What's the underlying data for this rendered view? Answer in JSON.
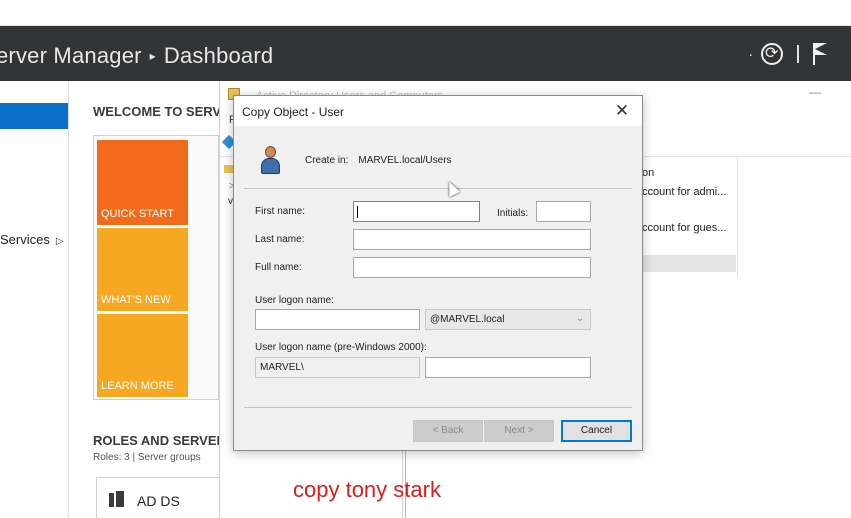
{
  "top_strip": {
    "text": ""
  },
  "header": {
    "app_title": "erver Manager",
    "separator": "▸",
    "page": "Dashboard"
  },
  "leftnav": {
    "services_label": "Services",
    "services_arrow": "▷"
  },
  "dashboard": {
    "welcome": "WELCOME TO SERVE",
    "tiles": {
      "quick_start": "QUICK START",
      "whats_new": "WHAT'S NEW",
      "learn_more": "LEARN MORE"
    },
    "roles_title": "ROLES AND SERVER",
    "roles_sub": "Roles: 3   |   Server groups",
    "adds_label": "AD DS"
  },
  "ad_window": {
    "title": "Active Directory Users and Computers",
    "menu_f": "F",
    "tree_gt": ">",
    "tree_v": "v",
    "desc_header": "on",
    "desc_rows": [
      "ccount for admi...",
      "ccount for gues..."
    ]
  },
  "dialog": {
    "title": "Copy Object - User",
    "close": "✕",
    "create_in_label": "Create in:",
    "create_in_value": "MARVEL.local/Users",
    "first_name_label": "First name:",
    "first_name_value": "",
    "initials_label": "Initials:",
    "initials_value": "",
    "last_name_label": "Last name:",
    "last_name_value": "",
    "full_name_label": "Full name:",
    "full_name_value": "",
    "logon_label": "User logon name:",
    "logon_value": "",
    "domain_value": "@MARVEL.local",
    "pre2000_label": "User logon name (pre-Windows 2000):",
    "pre2000_domain": "MARVEL\\",
    "pre2000_value": "",
    "buttons": {
      "back": "< Back",
      "next": "Next >",
      "cancel": "Cancel"
    }
  },
  "annotation": "copy tony stark",
  "colors": {
    "header_bg": "#333436",
    "nav_selected": "#0a6fc9",
    "tile_orange": "#f26b1d",
    "tile_amber": "#f7a823",
    "annotation": "#e01b1b"
  }
}
